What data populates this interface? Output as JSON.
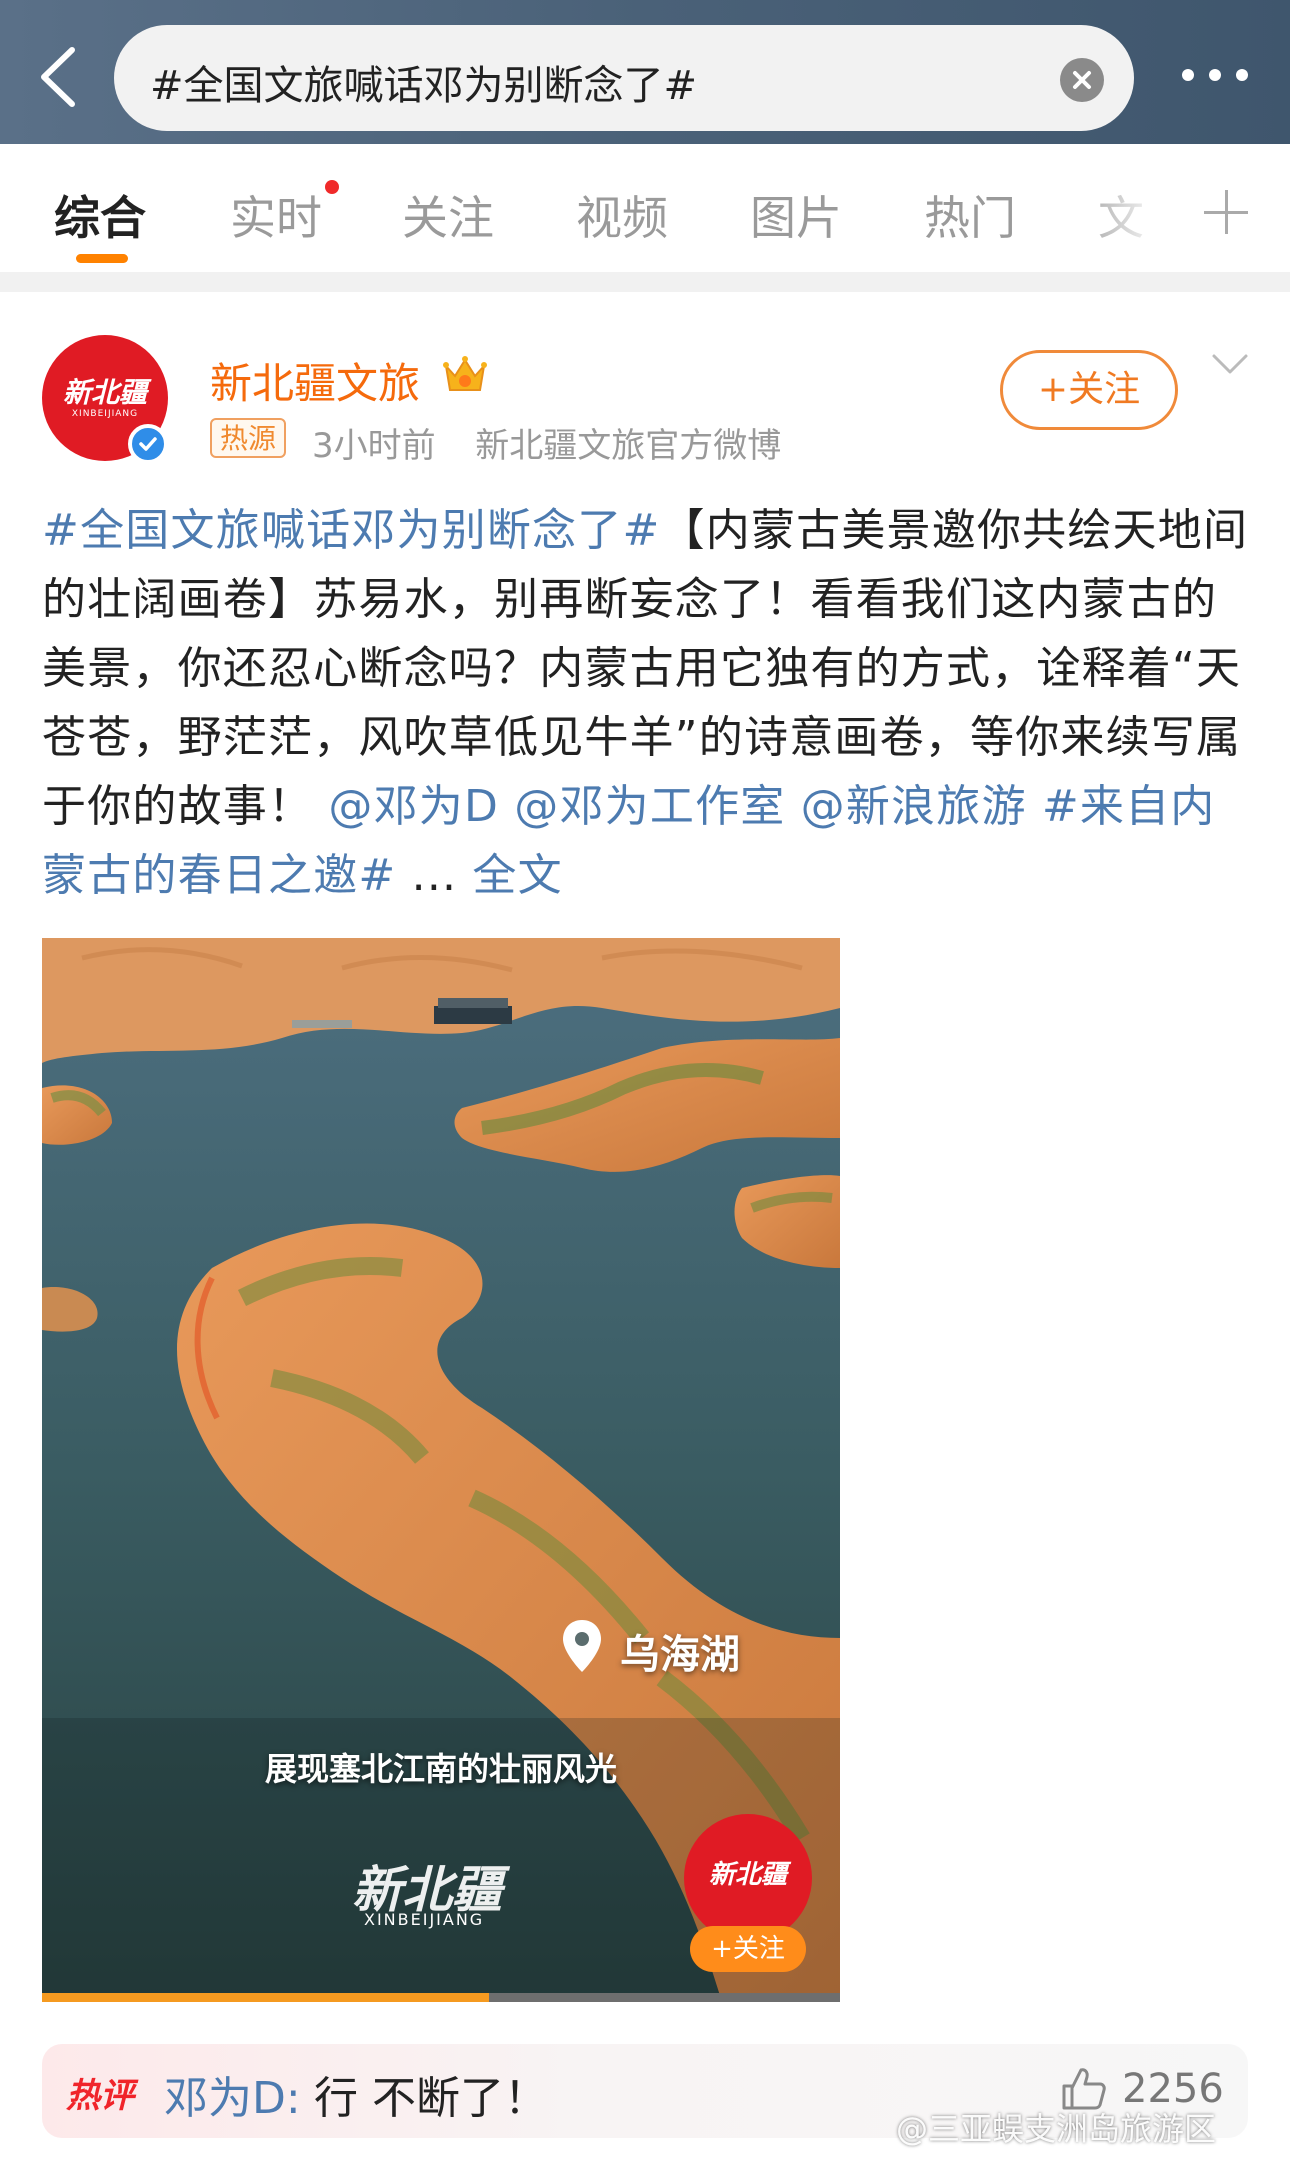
{
  "search": {
    "query": "#全国文旅喊话邓为别断念了#"
  },
  "tabs": [
    {
      "label": "综合",
      "active": true
    },
    {
      "label": "实时",
      "has_red_dot": true
    },
    {
      "label": "关注"
    },
    {
      "label": "视频"
    },
    {
      "label": "图片"
    },
    {
      "label": "热门"
    },
    {
      "label": "文"
    }
  ],
  "post": {
    "author": {
      "name": "新北疆文旅",
      "avatar_logo": "新北疆",
      "avatar_sub": "XINBEIJIANG",
      "badge": "热源",
      "time": "3小时前",
      "source": "新北疆文旅官方微博",
      "follow_label": "+关注"
    },
    "text": {
      "hashtag1": "#全国文旅喊话邓为别断念了#",
      "title": "【内蒙古美景邀你共绘天地间的壮阔画卷】",
      "body": "苏易水，别再断妄念了！看看我们这内蒙古的美景，你还忍心断念吗？内蒙古用它独有的方式，诠释着“天苍苍，野茫茫，风吹草低见牛羊”的诗意画卷，等你来续写属于你的故事！",
      "mention1": "@邓为D",
      "mention2": "@邓为工作室",
      "mention3": "@新浪旅游",
      "hashtag2": "#来自内蒙古的春日之邀#",
      "ellipsis": "...",
      "more": "全文"
    },
    "media": {
      "location": "乌海湖",
      "caption": "展现塞北江南的壮丽风光",
      "watermark": "新北疆",
      "watermark_sub": "XINBEIJIANG",
      "mini_logo": "新北疆",
      "mini_follow": "+关注",
      "progress": 0.56
    }
  },
  "hot_comment": {
    "badge": "热评",
    "user": "邓为D:",
    "text": "行 不断了！",
    "likes": "2256"
  },
  "watermark": "@三亚蜈支洲岛旅游区",
  "colors": {
    "accent": "#ff8200",
    "link": "#4d7bb0",
    "author": "#f56a0c",
    "hot_badge": "#f0242a"
  }
}
